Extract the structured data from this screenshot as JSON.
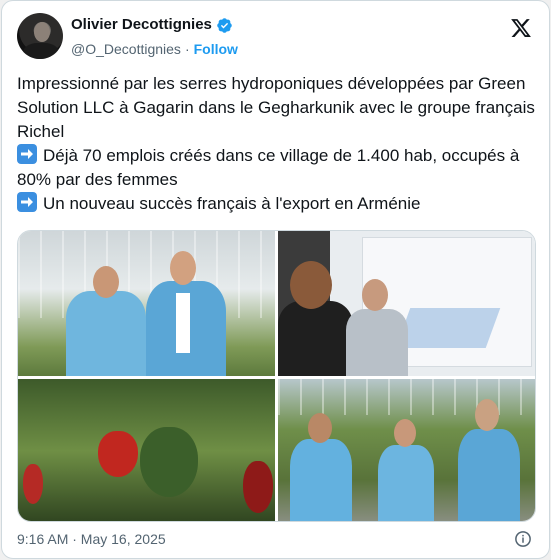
{
  "author": {
    "display_name": "Olivier Decottignies",
    "handle": "@O_Decottignies",
    "separator": "·",
    "follow_label": "Follow",
    "verified_color": "#1d9bf0"
  },
  "icons": {
    "verified": "verified-badge-icon",
    "x_logo": "x-logo-icon",
    "arrow": "right-arrow-emoji-icon",
    "info": "info-icon"
  },
  "tweet": {
    "line1": "Impressionné par les serres hydroponiques développées par Green Solution LLC à Gagarin dans le Gegharkunik avec le groupe français Richel",
    "line2": "Déjà 70 emplois créés dans ce village de 1.400 hab, occupés à 80% par des femmes",
    "line3": "Un nouveau succès français à l'export en Arménie"
  },
  "media": {
    "count": 4
  },
  "footer": {
    "timestamp": "9:16 AM · May 16, 2025"
  }
}
